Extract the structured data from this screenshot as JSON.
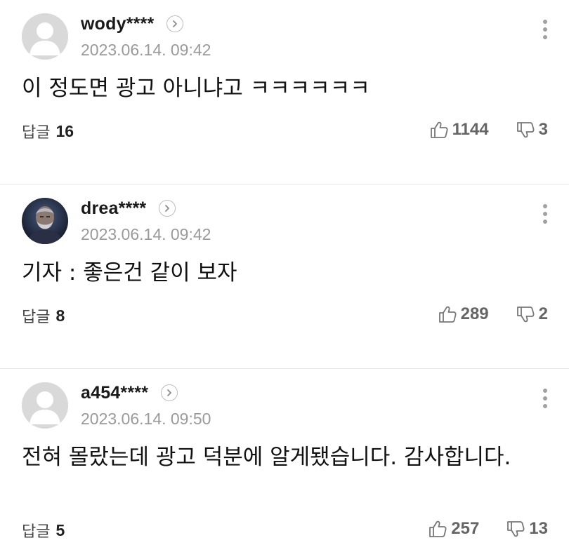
{
  "comments": [
    {
      "username": "wody****",
      "date": "2023.06.14. 09:42",
      "text": "이 정도면 광고 아니냐고 ㅋㅋㅋㅋㅋㅋ",
      "reply_label": "답글",
      "reply_count": "16",
      "likes": "1144",
      "dislikes": "3",
      "avatar": "default-avatar"
    },
    {
      "username": "drea****",
      "date": "2023.06.14. 09:42",
      "text": "기자 : 좋은건 같이 보자",
      "reply_label": "답글",
      "reply_count": "8",
      "likes": "289",
      "dislikes": "2",
      "avatar": "bearded-man-portrait"
    },
    {
      "username": "a454****",
      "date": "2023.06.14. 09:50",
      "text": "전혀 몰랐는데 광고 덕분에 알게됐습니다. 감사합니다.",
      "reply_label": "답글",
      "reply_count": "5",
      "likes": "257",
      "dislikes": "13",
      "avatar": "default-avatar"
    }
  ],
  "icons": {
    "profile": "chevron-right-circle-icon",
    "more": "more-vertical-icon",
    "like": "thumbs-up-icon",
    "dislike": "thumbs-down-icon"
  },
  "colors": {
    "text": "#111111",
    "meta": "#9a9a9a",
    "count": "#666666",
    "divider": "#e6e6e6"
  }
}
